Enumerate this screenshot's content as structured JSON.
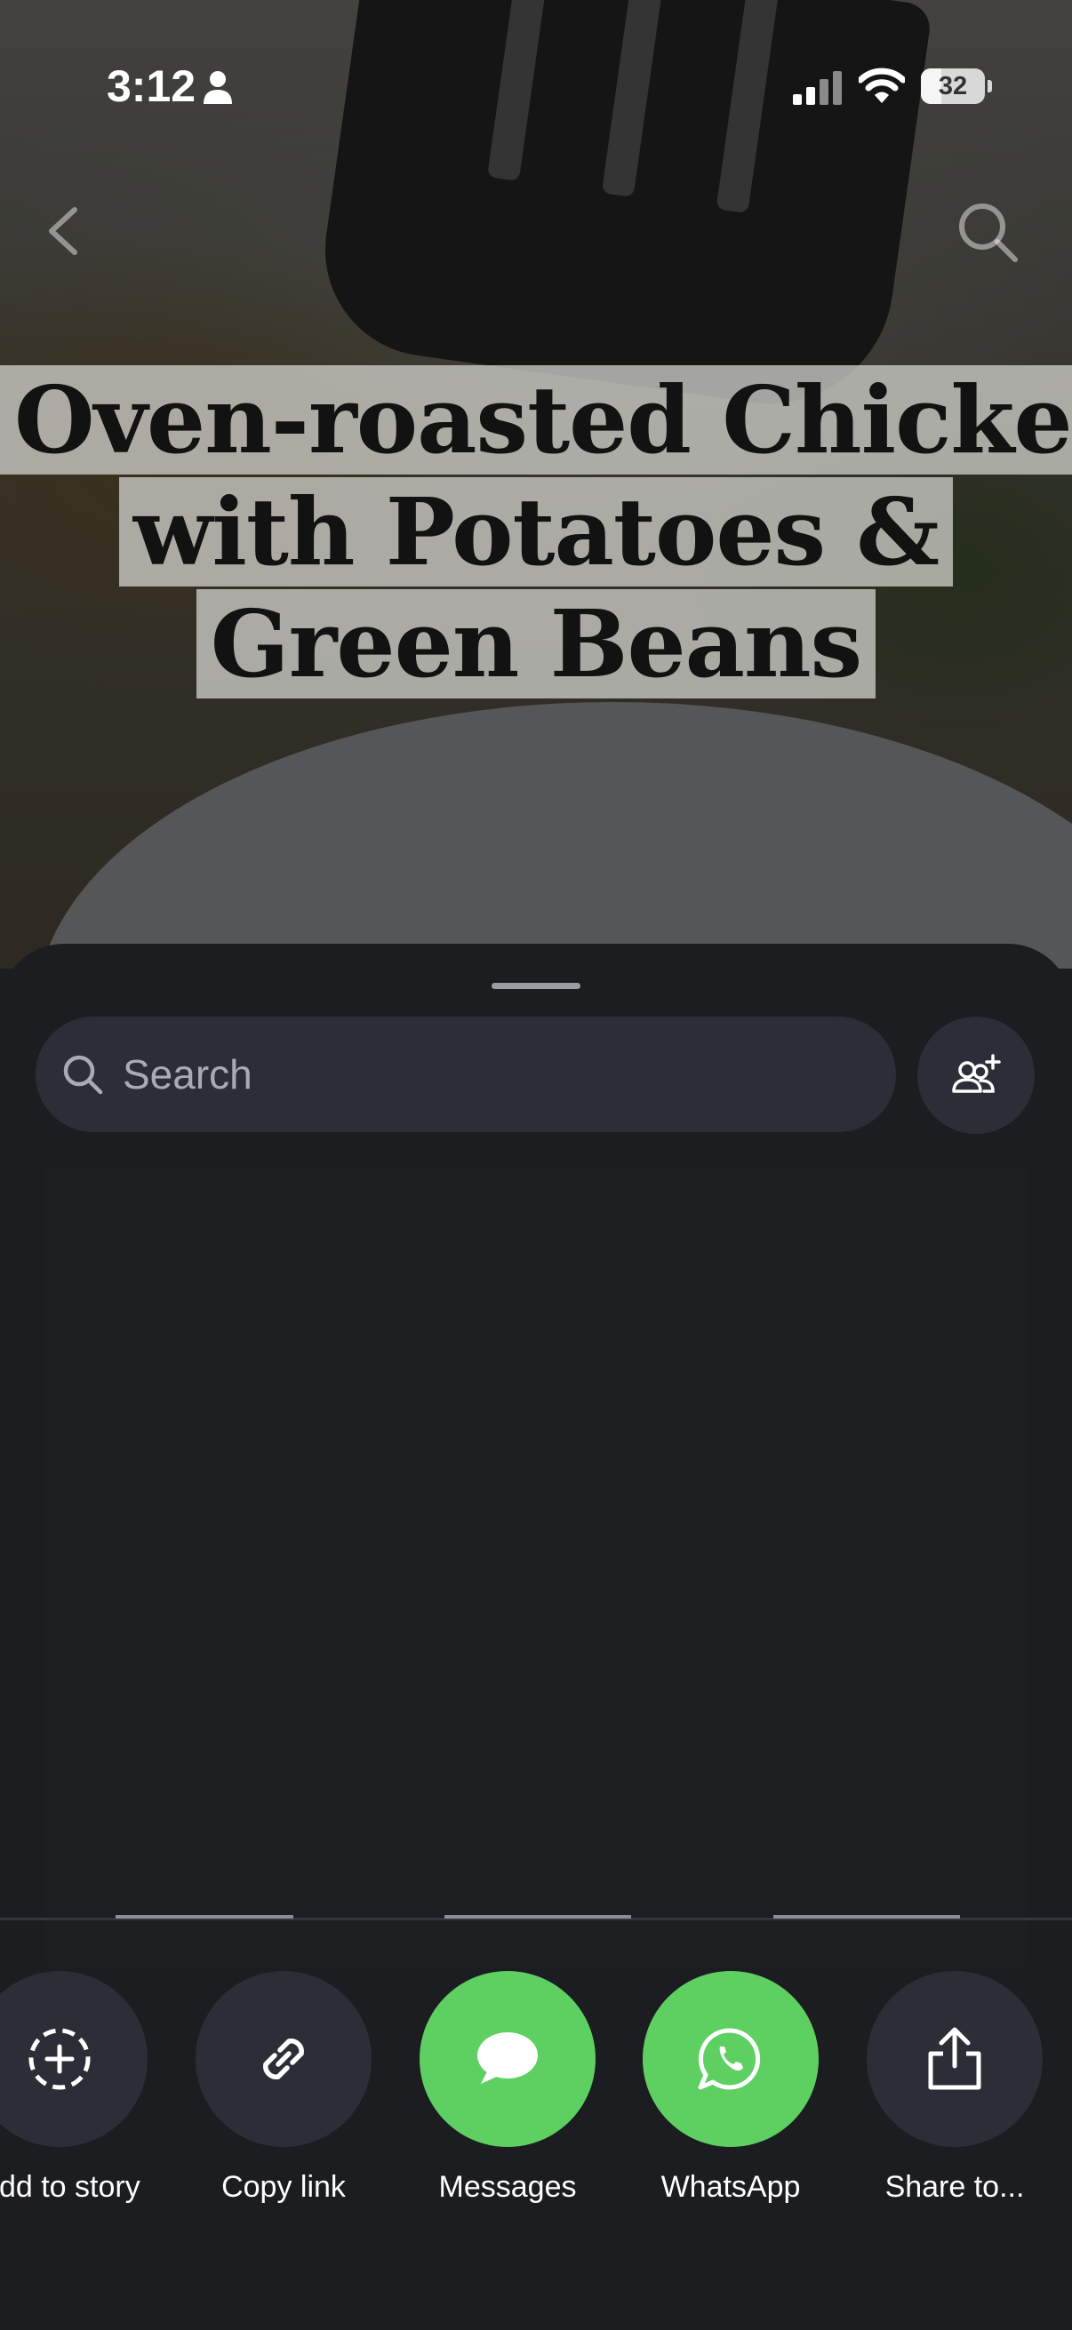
{
  "status_bar": {
    "time": "3:12",
    "battery": "32",
    "battery_level": 0.32
  },
  "background": {
    "title_lines": [
      "Oven-roasted Chicken",
      "with Potatoes &",
      "Green Beans"
    ]
  },
  "share_sheet": {
    "search": {
      "placeholder": "Search",
      "value": ""
    },
    "actions": [
      {
        "label": "Add to story",
        "icon": "add-story-icon"
      },
      {
        "label": "Copy link",
        "icon": "link-icon"
      },
      {
        "label": "Messages",
        "icon": "messages-icon",
        "color": "#5ecf61"
      },
      {
        "label": "WhatsApp",
        "icon": "whatsapp-icon",
        "color": "#5ecf61"
      },
      {
        "label": "Share to...",
        "icon": "share-icon"
      }
    ]
  },
  "colors": {
    "sheet_background": "#1b1d21",
    "field_background": "#2b2e36",
    "accent_green": "#5ecf61"
  }
}
